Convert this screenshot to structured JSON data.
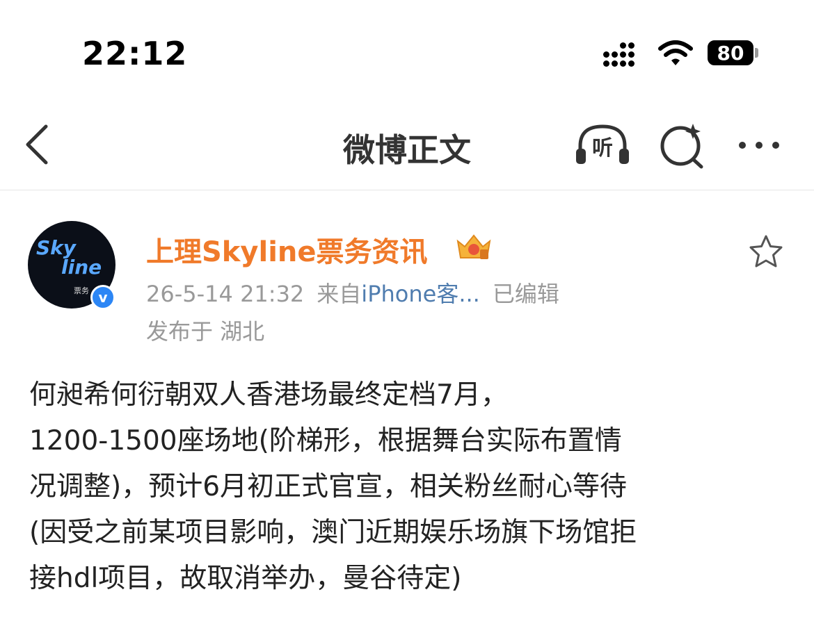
{
  "status_bar": {
    "time": "22:12",
    "battery": "80"
  },
  "header": {
    "title": "微博正文",
    "listen_label": "听"
  },
  "post": {
    "username": "上理Skyline票务资讯",
    "avatar_text": {
      "line1": "Sky",
      "line2": "line",
      "sub": "票务"
    },
    "verified_mark": "v",
    "date": "26-5-14 21:32",
    "source_prefix": "来自",
    "source": "iPhone客...",
    "edited": "已编辑",
    "location": "发布于 湖北",
    "content_lines": [
      "何昶希何衍朝双人香港场最终定档7月，",
      "1200-1500座场地(阶梯形，根据舞台实际布置情",
      "况调整)，预计6月初正式官宣，相关粉丝耐心等待",
      " (因受之前某项目影响，澳门近期娱乐场旗下场馆拒",
      "接hdl项目，故取消举办，曼谷待定)"
    ]
  },
  "icons": [
    "back-arrow-icon",
    "listen-icon",
    "search-icon",
    "more-icon",
    "star-icon",
    "crown-badge-icon",
    "verified-icon"
  ],
  "colors": {
    "username": "#f07a2a",
    "source_link": "#507daf",
    "meta": "#999999",
    "verified": "#2c86f5"
  }
}
